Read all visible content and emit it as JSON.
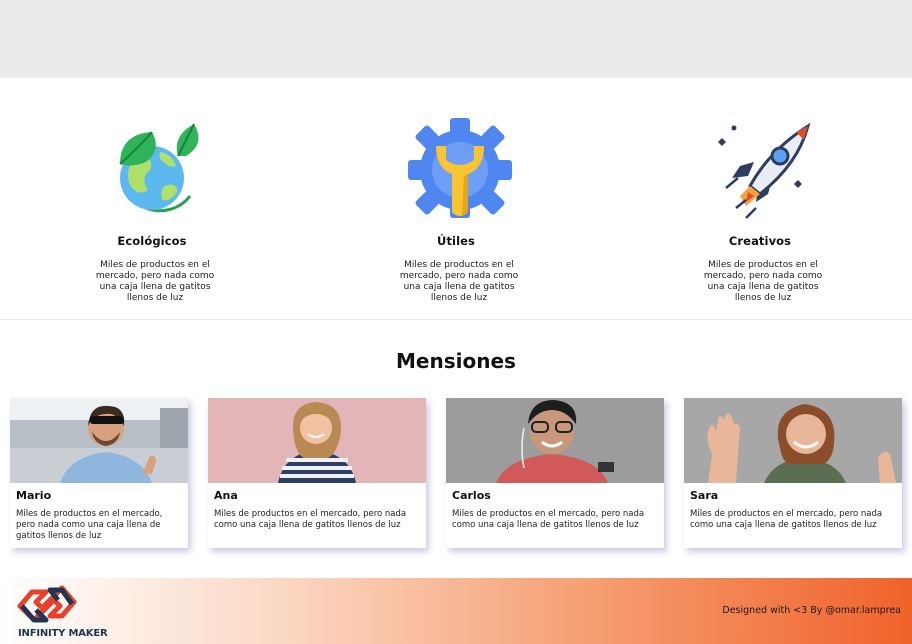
{
  "features": [
    {
      "title": "Ecológicos",
      "desc": "Miles de productos en el mercado, pero nada como una caja llena de gatitos llenos de luz",
      "icon": "eco-globe-icon"
    },
    {
      "title": "Útiles",
      "desc": "Miles de productos en el mercado, pero nada como una caja llena de gatitos llenos de luz",
      "icon": "wrench-gear-icon"
    },
    {
      "title": "Creativos",
      "desc": "Miles de productos en el mercado, pero nada como una caja llena de gatitos llenos de luz",
      "icon": "rocket-icon"
    }
  ],
  "mentions": {
    "title": "Mensiones",
    "cards": [
      {
        "name": "Mario",
        "desc": "Miles de productos en el mercado, pero nada como una caja llena de gatitos llenos de luz"
      },
      {
        "name": "Ana",
        "desc": "Miles de productos en el mercado, pero nada como una caja llena de gatitos llenos de luz"
      },
      {
        "name": "Carlos",
        "desc": "Miles de productos en el mercado, pero nada como una caja llena de gatitos llenos de luz"
      },
      {
        "name": "Sara",
        "desc": "Miles de productos en el mercado, pero nada como una caja llena de gatitos llenos de luz"
      }
    ]
  },
  "footer": {
    "logo_text": "INFINITY MAKER",
    "credit": "Designed with <3 By @omar.lamprea"
  },
  "colors": {
    "accent": "#f0622a",
    "logo_red": "#e8402a",
    "logo_navy": "#1f3550"
  }
}
